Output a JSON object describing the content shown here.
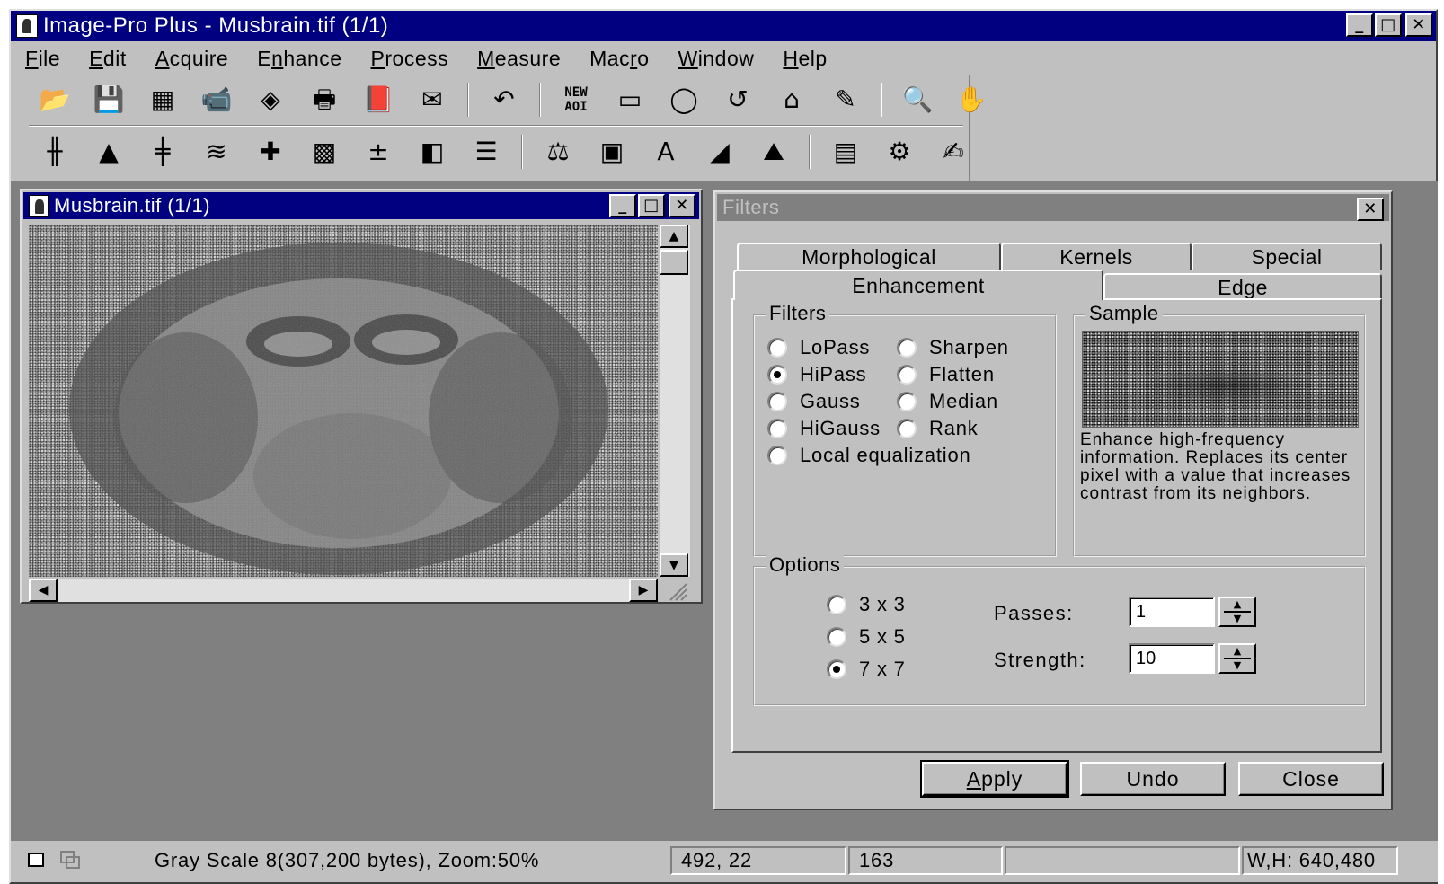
{
  "app": {
    "title": "Image-Pro Plus - Musbrain.tif (1/1)",
    "window_buttons": {
      "minimize": "_",
      "maximize": "□",
      "close": "✕"
    }
  },
  "menu": {
    "items": [
      {
        "pre": "",
        "u": "F",
        "post": "ile"
      },
      {
        "pre": "",
        "u": "E",
        "post": "dit"
      },
      {
        "pre": "",
        "u": "A",
        "post": "cquire"
      },
      {
        "pre": "E",
        "u": "n",
        "post": "hance"
      },
      {
        "pre": "",
        "u": "P",
        "post": "rocess"
      },
      {
        "pre": "",
        "u": "M",
        "post": "easure"
      },
      {
        "pre": "Mac",
        "u": "r",
        "post": "o"
      },
      {
        "pre": "",
        "u": "W",
        "post": "indow"
      },
      {
        "pre": "",
        "u": "H",
        "post": "elp"
      }
    ]
  },
  "toolbar": {
    "row1": [
      {
        "name": "open-icon",
        "glyph": "📂"
      },
      {
        "name": "save-icon",
        "glyph": "💾"
      },
      {
        "name": "grid-icon",
        "glyph": "▦"
      },
      {
        "name": "camera-icon",
        "glyph": "📹"
      },
      {
        "name": "eraser-icon",
        "glyph": "◈"
      },
      {
        "name": "print-icon",
        "glyph": "🖶"
      },
      {
        "name": "book-icon",
        "glyph": "📕"
      },
      {
        "name": "mail-icon",
        "glyph": "✉"
      },
      {
        "name": "sep"
      },
      {
        "name": "undo-icon",
        "glyph": "↶"
      },
      {
        "name": "sep"
      },
      {
        "name": "new-aoi-icon",
        "glyph": "NEW AOI"
      },
      {
        "name": "rectangle-icon",
        "glyph": "▭"
      },
      {
        "name": "ellipse-icon",
        "glyph": "◯"
      },
      {
        "name": "freehand-icon",
        "glyph": "↺"
      },
      {
        "name": "polygon-icon",
        "glyph": "⌂"
      },
      {
        "name": "pencil-icon",
        "glyph": "✎"
      },
      {
        "name": "sep"
      },
      {
        "name": "zoom-icon",
        "glyph": "🔍"
      },
      {
        "name": "hand-icon",
        "glyph": "✋"
      }
    ],
    "row2": [
      {
        "name": "levels-icon",
        "glyph": "╫"
      },
      {
        "name": "histogram-icon",
        "glyph": "▲"
      },
      {
        "name": "contrast-icon",
        "glyph": "╪"
      },
      {
        "name": "layers-icon",
        "glyph": "≋"
      },
      {
        "name": "filter-icon",
        "glyph": "✚"
      },
      {
        "name": "mesh-icon",
        "glyph": "▩"
      },
      {
        "name": "math-icon",
        "glyph": "±"
      },
      {
        "name": "threshold-icon",
        "glyph": "◧"
      },
      {
        "name": "palette-icon",
        "glyph": "☰"
      },
      {
        "name": "sep"
      },
      {
        "name": "calibration-icon",
        "glyph": "⚖"
      },
      {
        "name": "count-icon",
        "glyph": "▣"
      },
      {
        "name": "text-icon",
        "glyph": "A"
      },
      {
        "name": "line-profile-icon",
        "glyph": "◢"
      },
      {
        "name": "graph-icon",
        "glyph": "⛰"
      },
      {
        "name": "sep"
      },
      {
        "name": "database-icon",
        "glyph": "▤"
      },
      {
        "name": "macro-icon",
        "glyph": "⚙"
      },
      {
        "name": "report-icon",
        "glyph": "✍"
      }
    ]
  },
  "image_window": {
    "title": "Musbrain.tif (1/1)",
    "scroll_up": "▲",
    "scroll_down": "▼",
    "scroll_left": "◀",
    "scroll_right": "▶"
  },
  "dialog": {
    "title": "Filters",
    "close": "✕",
    "tabs_back": [
      "Morphological",
      "Kernels",
      "Special"
    ],
    "tabs_front": [
      "Enhancement",
      "Edge"
    ],
    "active_tab": "Enhancement",
    "filters_group": {
      "label": "Filters",
      "options": [
        {
          "label": "LoPass",
          "checked": false
        },
        {
          "label": "Sharpen",
          "checked": false
        },
        {
          "label": "HiPass",
          "checked": true
        },
        {
          "label": "Flatten",
          "checked": false
        },
        {
          "label": "Gauss",
          "checked": false
        },
        {
          "label": "Median",
          "checked": false
        },
        {
          "label": "HiGauss",
          "checked": false
        },
        {
          "label": "Rank",
          "checked": false
        },
        {
          "label": "Local equalization",
          "checked": false
        }
      ]
    },
    "sample_group": {
      "label": "Sample",
      "description": "Enhance high-frequency information. Replaces its center pixel with a value that increases contrast from its neighbors."
    },
    "options_group": {
      "label": "Options",
      "sizes": [
        {
          "label": "3 x 3",
          "checked": false
        },
        {
          "label": "5 x 5",
          "checked": false
        },
        {
          "label": "7 x 7",
          "checked": true
        }
      ],
      "passes_label": "Passes:",
      "passes_value": "1",
      "strength_label": "Strength:",
      "strength_value": "10"
    },
    "buttons": {
      "apply_u": "A",
      "apply_rest": "pply",
      "undo": "Undo",
      "close": "Close"
    }
  },
  "status": {
    "info": "Gray Scale 8(307,200 bytes), Zoom:50%",
    "coords": "492,  22",
    "value": "163",
    "blank": "",
    "size": "W,H: 640,480"
  }
}
